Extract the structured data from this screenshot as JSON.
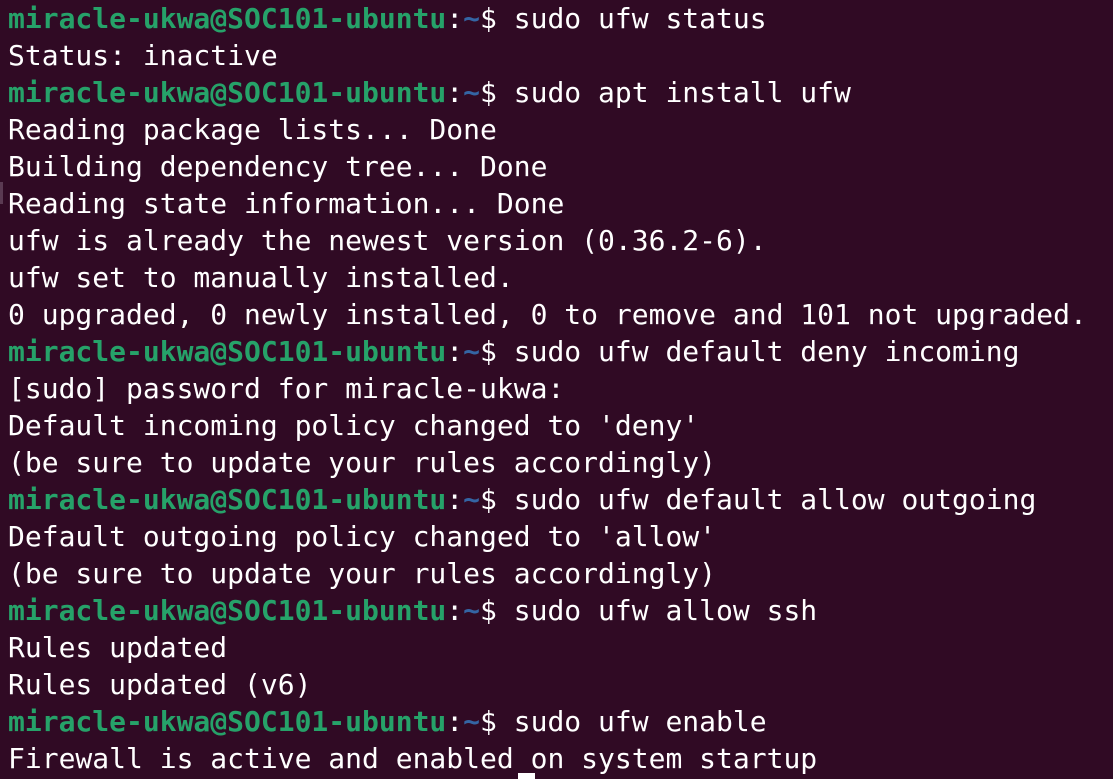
{
  "prompt": {
    "user_host": "miracle-ukwa@SOC101-ubuntu",
    "separator": ":",
    "path": "~",
    "symbol": "$ "
  },
  "commands": [
    "sudo ufw status",
    "sudo apt install ufw",
    "sudo ufw default deny incoming",
    "sudo ufw default allow outgoing",
    "sudo ufw allow ssh",
    "sudo ufw enable"
  ],
  "outputs": [
    [
      "Status: inactive"
    ],
    [
      "Reading package lists... Done",
      "Building dependency tree... Done",
      "Reading state information... Done",
      "ufw is already the newest version (0.36.2-6).",
      "ufw set to manually installed.",
      "0 upgraded, 0 newly installed, 0 to remove and 101 not upgraded."
    ],
    [
      "[sudo] password for miracle-ukwa:",
      "Default incoming policy changed to 'deny'",
      "(be sure to update your rules accordingly)"
    ],
    [
      "Default outgoing policy changed to 'allow'",
      "(be sure to update your rules accordingly)"
    ],
    [
      "Rules updated",
      "Rules updated (v6)"
    ],
    [
      "Firewall is active and enabled on system startup"
    ]
  ],
  "colors": {
    "background": "#300a24",
    "prompt_user": "#26a269",
    "prompt_path": "#3465a4",
    "text": "#ffffff"
  }
}
